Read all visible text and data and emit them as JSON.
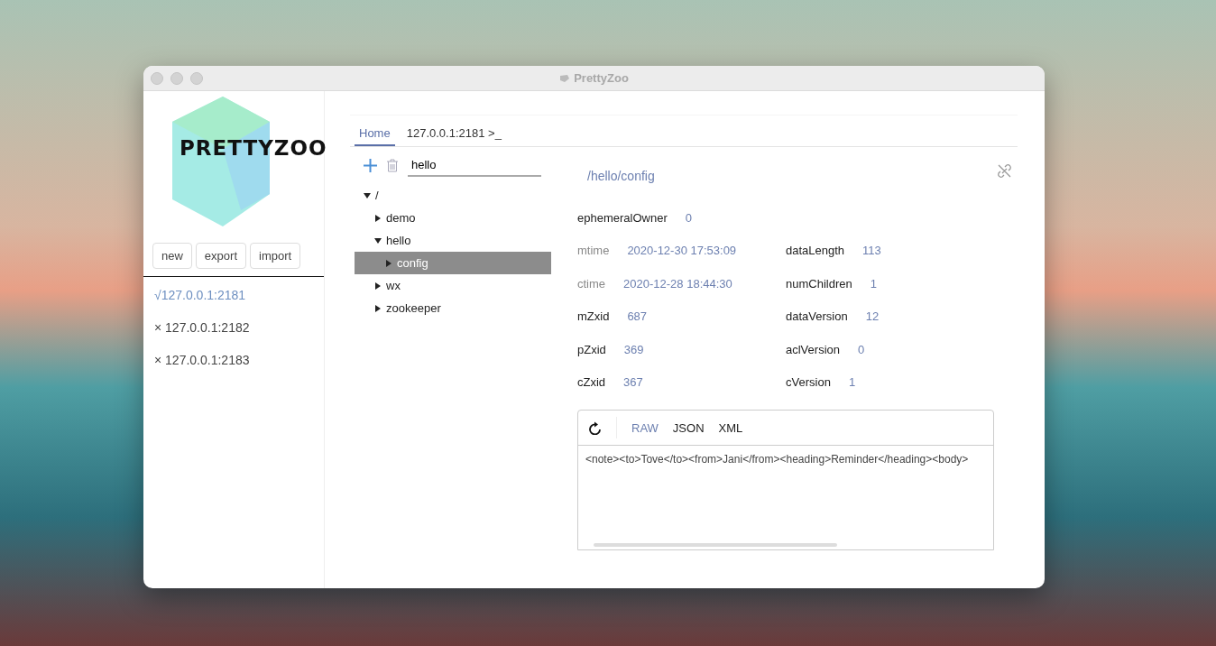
{
  "window": {
    "title": "PrettyZoo"
  },
  "sidebar": {
    "logo_text": "PRETTYZOO",
    "buttons": [
      "new",
      "export",
      "import"
    ],
    "servers": [
      {
        "label": "√127.0.0.1:2181",
        "selected": true
      },
      {
        "label": "× 127.0.0.1:2182",
        "selected": false
      },
      {
        "label": "× 127.0.0.1:2183",
        "selected": false
      }
    ]
  },
  "tabs": [
    {
      "label": "Home",
      "selected": true
    },
    {
      "label": "127.0.0.1:2181 >_",
      "selected": false
    }
  ],
  "search": {
    "value": "hello"
  },
  "tree": [
    {
      "label": "/",
      "expanded": true,
      "selected": false,
      "children": [
        {
          "label": "demo",
          "expanded": false,
          "selected": false
        },
        {
          "label": "hello",
          "expanded": true,
          "selected": false,
          "children": [
            {
              "label": "config",
              "expanded": false,
              "selected": true
            }
          ]
        },
        {
          "label": "wx",
          "expanded": false,
          "selected": false
        },
        {
          "label": "zookeeper",
          "expanded": false,
          "selected": false
        }
      ]
    }
  ],
  "node": {
    "path": "/hello/config",
    "owner": {
      "label": "ephemeralOwner",
      "value": "0",
      "dim": false
    },
    "stats": [
      [
        {
          "label": "mtime",
          "value": "2020-12-30 17:53:09",
          "dim": true
        },
        {
          "label": "dataLength",
          "value": "113",
          "dim": false
        }
      ],
      [
        {
          "label": "ctime",
          "value": "2020-12-28 18:44:30",
          "dim": true
        },
        {
          "label": "numChildren",
          "value": "1",
          "dim": false
        }
      ],
      [
        {
          "label": "mZxid",
          "value": "687",
          "dim": false
        },
        {
          "label": "dataVersion",
          "value": "12",
          "dim": false
        }
      ],
      [
        {
          "label": "pZxid",
          "value": "369",
          "dim": false
        },
        {
          "label": "aclVersion",
          "value": "0",
          "dim": false
        }
      ],
      [
        {
          "label": "cZxid",
          "value": "367",
          "dim": false
        },
        {
          "label": "cVersion",
          "value": "1",
          "dim": false
        }
      ]
    ]
  },
  "editor": {
    "formats": [
      {
        "label": "RAW",
        "selected": true
      },
      {
        "label": "JSON",
        "selected": false
      },
      {
        "label": "XML",
        "selected": false
      }
    ],
    "content": "<note><to>Tove</to><from>Jani</from><heading>Reminder</heading><body>"
  }
}
